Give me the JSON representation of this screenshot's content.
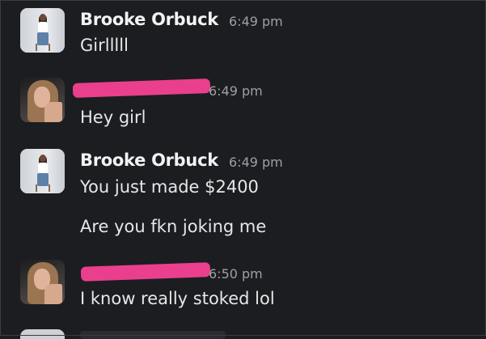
{
  "messages": [
    {
      "sender": "Brooke Orbuck",
      "time": "6:49 pm",
      "lines": [
        "Girlllll"
      ],
      "avatar": "brooke-avatar"
    },
    {
      "sender": "",
      "time": "6:49 pm",
      "lines": [
        "Hey girl"
      ],
      "avatar": "eli-avatar",
      "sender_redacted": true
    },
    {
      "sender": "Brooke Orbuck",
      "time": "6:49 pm",
      "lines": [
        "You just made $2400",
        "Are you fkn joking me"
      ],
      "avatar": "brooke-avatar"
    },
    {
      "sender": "",
      "time": "6:50 pm",
      "lines": [
        "I know really stoked lol"
      ],
      "avatar": "eli-avatar",
      "sender_redacted": true
    }
  ],
  "colors": {
    "background": "#1b1d21",
    "redaction": "#ea3f8c",
    "timestamp": "#9ea0a3"
  }
}
